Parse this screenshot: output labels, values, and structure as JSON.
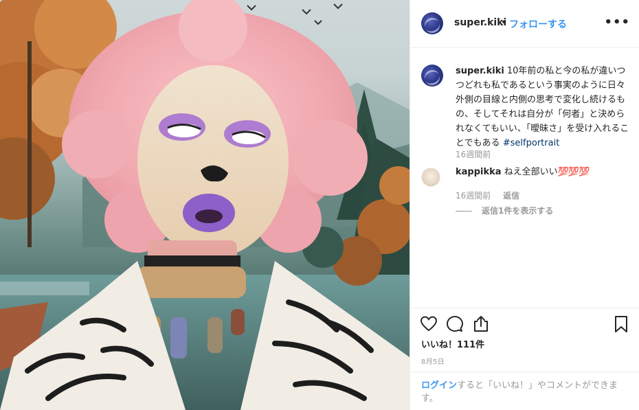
{
  "header": {
    "username": "super.kiki",
    "dot": "•",
    "follow_label": "フォローする",
    "more_label": "•••"
  },
  "caption": {
    "username": "super.kiki",
    "text": "10年前の私と今の私が違いつつどれも私であるという事実のように日々外側の目線と内側の思考で変化し続けるもの、そしてそれは自分が「何者」と決められなくてもいい、「曖昧さ」を受け入れることでもある",
    "hashtag": "#selfportrait",
    "time": "16週間前"
  },
  "comments": [
    {
      "username": "kappikka",
      "text": "ねえ全部いい",
      "emoji": "💯💯💯",
      "time": "16週間前",
      "reply_label": "返信",
      "view_replies_label": "返信1件を表示する"
    }
  ],
  "actions": {
    "like_icon": "heart-icon",
    "comment_icon": "comment-bubble-icon",
    "share_icon": "share-icon",
    "save_icon": "bookmark-icon"
  },
  "likes": "いいね！111件",
  "date": "8月5日",
  "footer": {
    "login_label": "ログイン",
    "text": "すると「いいね！」やコメントができます。"
  },
  "colors": {
    "accent": "#3897f0",
    "text": "#262626",
    "muted": "#999999",
    "hashtag": "#003569"
  }
}
